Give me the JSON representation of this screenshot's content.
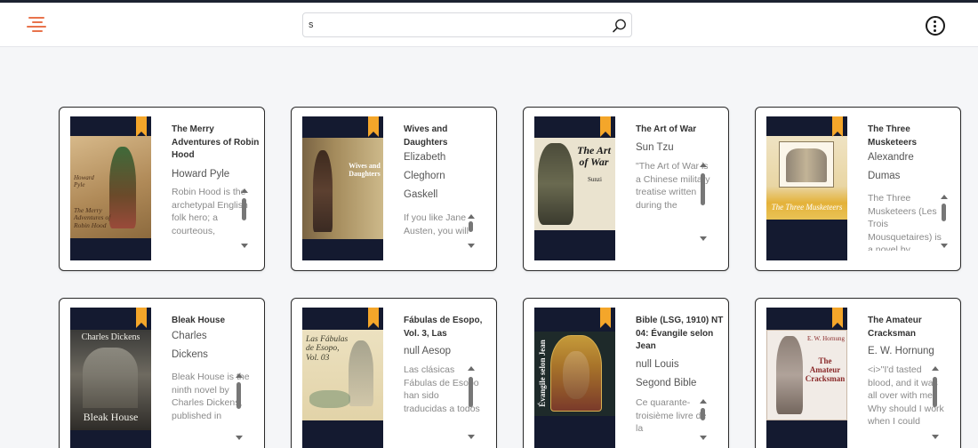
{
  "header": {
    "search_value": "s",
    "icons": {
      "menu": "hamburger-icon",
      "search": "magnifier-icon",
      "more": "kebab-icon"
    },
    "accent": "#e8734c"
  },
  "books": [
    {
      "title": "The Merry Adventures of Robin Hood",
      "meta": [
        "Howard Pyle"
      ],
      "description": "Robin Hood is the archetypal English folk hero; a courteous,",
      "cover_text": "Howard Pyle The Merry Adventures of Robin Hood"
    },
    {
      "title": "Wives and Daughters",
      "meta": [
        "Elizabeth",
        "Cleghorn",
        "Gaskell"
      ],
      "description": "If you like Jane Austen, you will",
      "cover_text": "Wives and Daughters"
    },
    {
      "title": "The Art of War",
      "meta": [
        "Sun Tzu"
      ],
      "description": "\"The Art of War is a Chinese military treatise written during the",
      "cover_text": "The Art of War Sunzi"
    },
    {
      "title": "The Three Musketeers",
      "meta": [
        "Alexandre",
        "Dumas"
      ],
      "description": "The Three Musketeers (Les Trois Mousquetaires) is a novel by",
      "cover_text": "The Three Musketeers"
    },
    {
      "title": "Bleak House",
      "meta": [
        "Charles",
        "Dickens"
      ],
      "description": "Bleak House is the ninth novel by Charles Dickens, published in",
      "cover_text": "Charles Dickens Bleak House"
    },
    {
      "title": "Fábulas de Esopo, Vol. 3, Las",
      "meta": [
        "null Aesop"
      ],
      "description": "Las clásicas Fábulas de Esopo han sido traducidas a todos",
      "cover_text": "Las Fábulas de Esopo, Vol. 03"
    },
    {
      "title": "Bible (LSG, 1910) NT 04: Évangile selon Jean",
      "meta": [
        "null Louis",
        "Segond Bible"
      ],
      "description": "Ce quarante-troisième livre de la",
      "cover_text": "Évangile selon Jean"
    },
    {
      "title": "The Amateur Cracksman",
      "meta": [
        "E. W. Hornung"
      ],
      "description": "<i>\"I'd tasted blood, and it was all over with me. Why should I work when I could",
      "cover_text": "E. W. Hornung The Amateur Cracksman"
    }
  ]
}
